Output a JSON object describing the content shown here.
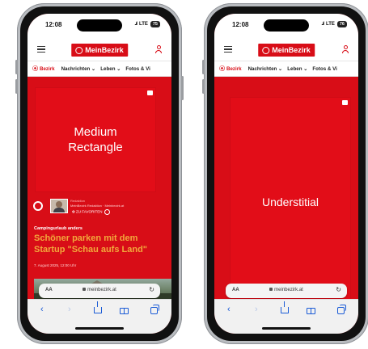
{
  "phones": [
    {
      "time": "12:08",
      "signal": "..ıl",
      "network": "LTE",
      "battery": "75",
      "logo_text": "MeinBezirk",
      "nav": {
        "location": "Bezirk",
        "items": [
          "Nachrichten ⌄",
          "Leben ⌄",
          "Fotos & Vi"
        ]
      },
      "ad_label_line1": "Medium",
      "ad_label_line2": "Rectangle",
      "author": {
        "name": "Redaktion",
        "role": "MeinBezirk Redaktion · Meinbezirk.at",
        "follow": "✿ ZU FAVORITEN"
      },
      "category": "Campingurlaub anders",
      "headline": "Schöner parken mit dem Startup \"Schau aufs Land\"",
      "date": "7. August 2025, 12:00 Uhr",
      "url": "meinbezirk.at",
      "url_aa": "AA",
      "reload": "↻"
    },
    {
      "time": "12:08",
      "signal": "..ıl",
      "network": "LTE",
      "battery": "76",
      "logo_text": "MeinBezirk",
      "nav": {
        "location": "Bezirk",
        "items": [
          "Nachrichten ⌄",
          "Leben ⌄",
          "Fotos & Vi"
        ]
      },
      "interstitial_label": "Understitial",
      "url": "meinbezirk.at",
      "url_aa": "AA",
      "reload": "↻"
    }
  ],
  "toolbar": {
    "back": "‹",
    "forward": "›"
  },
  "colors": {
    "brand_red": "#d80d17",
    "ad_red": "#e20d18",
    "headline_orange": "#f2a83b",
    "safari_blue": "#1a5bd6"
  }
}
